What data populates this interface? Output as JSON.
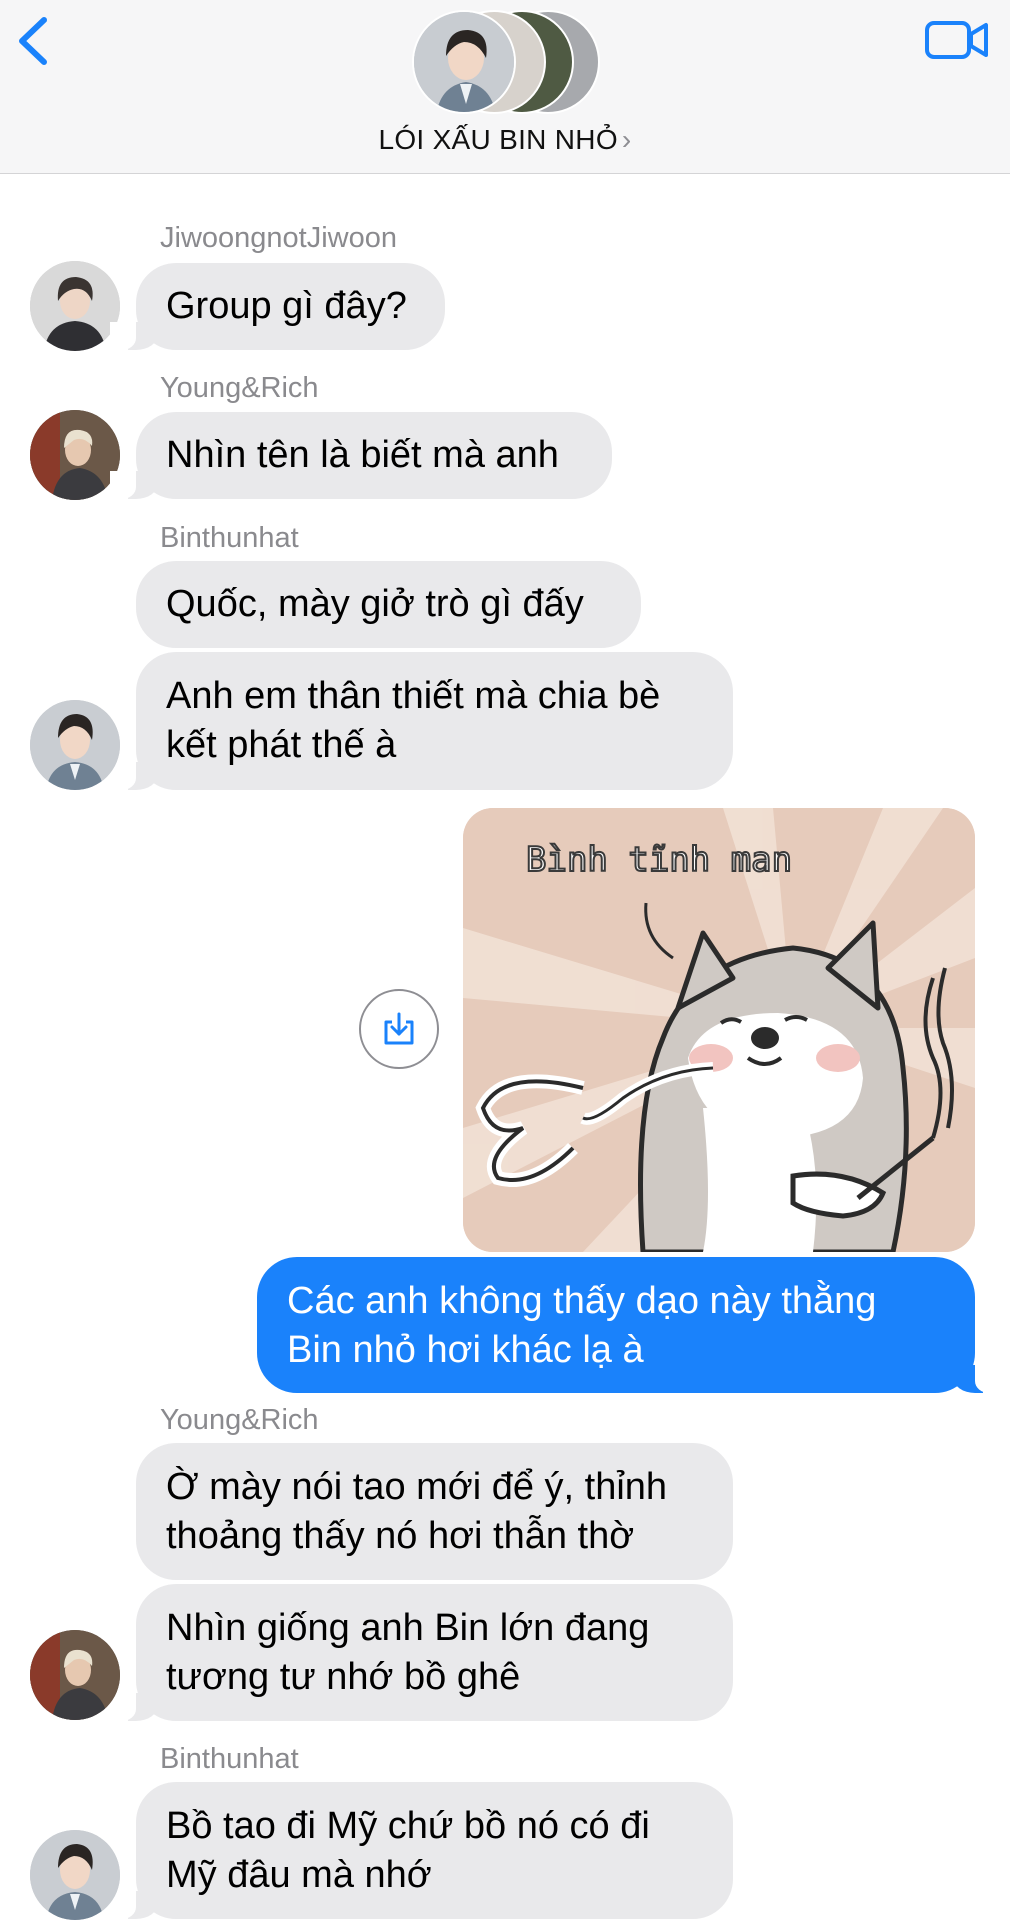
{
  "header": {
    "title": "LÓI XẤU BIN NHỎ",
    "chevron": "›",
    "accent": "#1a82fb"
  },
  "messages": [
    {
      "sender": "JiwoongnotJiwoon",
      "texts": [
        "Group gì đây?"
      ]
    },
    {
      "sender": "Young&Rich",
      "texts": [
        "Nhìn tên là biết mà anh"
      ]
    },
    {
      "sender": "Binthunhat",
      "texts": [
        "Quốc, mày giở trò gì đấy",
        "Anh em thân thiết mà chia bè\nkết phát thế à"
      ]
    },
    {
      "sticker_caption": "Bình tĩnh man"
    },
    {
      "outgoing": "Các anh không thấy dạo này thằng\nBin nhỏ hơi khác lạ à"
    },
    {
      "sender": "Young&Rich",
      "texts": [
        "Ờ mày nói tao mới để ý, thỉnh\nthoảng thấy nó hơi thẫn thờ",
        "Nhìn giống anh Bin lớn đang\ntương tư nhớ bồ ghê"
      ]
    },
    {
      "sender": "Binthunhat",
      "texts": [
        "Bồ tao đi Mỹ chứ bồ nó có đi\nMỹ đâu mà nhớ"
      ]
    }
  ],
  "icons": [
    "back-chevron-icon",
    "video-camera-icon",
    "save-download-icon"
  ]
}
